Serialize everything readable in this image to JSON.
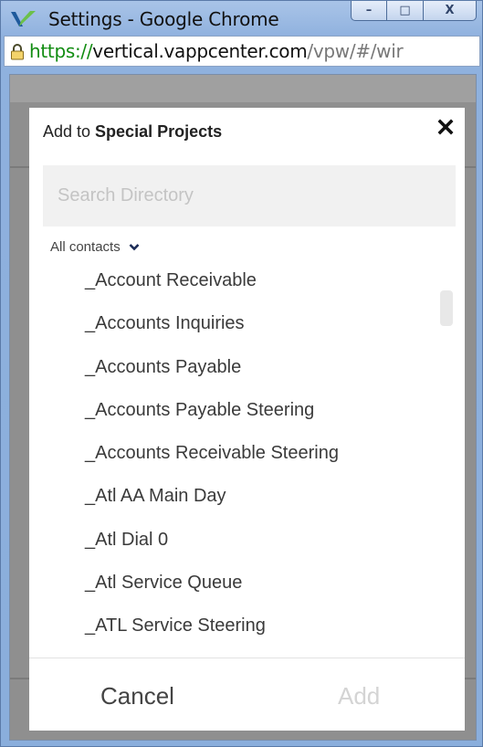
{
  "window": {
    "title": "Settings - Google Chrome",
    "controls": {
      "minimize": "–",
      "maximize": "□",
      "close": "X"
    }
  },
  "address": {
    "scheme": "https://",
    "host": "vertical.vappcenter.com",
    "path": "/vpw/#/wir",
    "icon": "lock-icon"
  },
  "dialog": {
    "title_prefix": "Add to ",
    "title_bold": "Special Projects",
    "close_icon": "close-icon",
    "search": {
      "placeholder": "Search Directory",
      "value": ""
    },
    "filter": {
      "label": "All contacts",
      "icon": "chevron-down-icon"
    },
    "contacts": [
      "_Account Receivable",
      "_Accounts Inquiries",
      "_Accounts Payable",
      "_Accounts Payable Steering",
      "_Accounts Receivable Steering",
      "_Atl AA Main Day",
      "_Atl Dial 0",
      "_Atl Service Queue",
      "_ATL Service Steering"
    ],
    "buttons": {
      "cancel": "Cancel",
      "add": "Add"
    }
  },
  "colors": {
    "secure_green": "#118c11",
    "add_disabled": "#d4d4d4",
    "overlay": "#8f8f8f",
    "logo_green": "#6cc04a",
    "logo_blue": "#1e5a9c"
  }
}
